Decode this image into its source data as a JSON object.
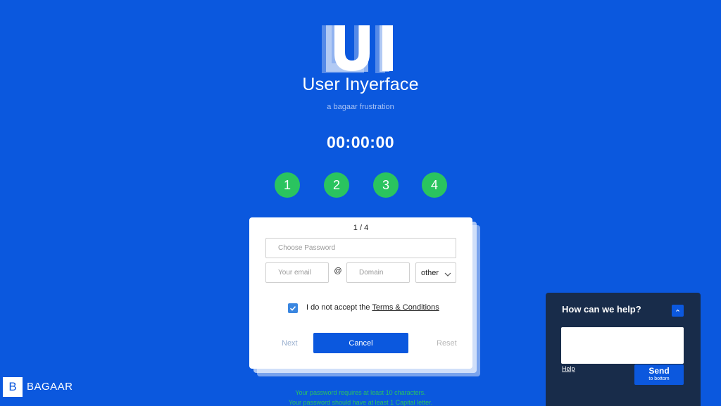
{
  "header": {
    "logo_text": "UI",
    "title": "User Inyerface",
    "subtitle": "a bagaar frustration",
    "timer": "00:00:00"
  },
  "steps": [
    "1",
    "2",
    "3",
    "4"
  ],
  "card": {
    "counter": "1 / 4",
    "password_placeholder": "Choose Password",
    "email_placeholder": "Your email",
    "at_sign": "@",
    "domain_placeholder": "Domain",
    "tld_selected": "other",
    "terms_prefix": "I do not accept the ",
    "terms_link": "Terms & Conditions",
    "terms_checked": true,
    "next_label": "Next",
    "cancel_label": "Cancel",
    "reset_label": "Reset"
  },
  "validation": [
    "Your password requires at least 10 characters.",
    "Your password should have at least 1 Capital letter."
  ],
  "brand": {
    "mark": "B",
    "name": "BAGAAR"
  },
  "help": {
    "title": "How can we help?",
    "link": "Help",
    "send_label": "Send",
    "send_sub": "to bottom"
  },
  "colors": {
    "background": "#0b58de",
    "step_circle": "#2ac45f",
    "validation_text": "#2ac45f",
    "help_panel": "#182c4a",
    "checkbox": "#3a86e0"
  }
}
